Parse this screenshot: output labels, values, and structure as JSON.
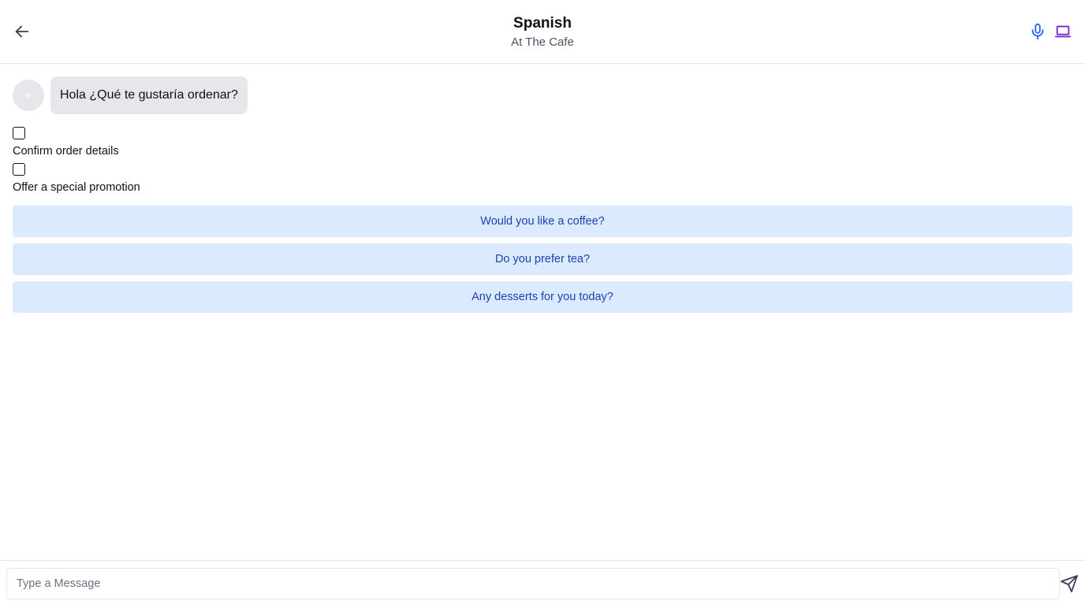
{
  "header": {
    "title": "Spanish",
    "subtitle": "At The Cafe",
    "icons": {
      "back": "arrow-left-icon",
      "mic": "microphone-icon",
      "laptop": "laptop-icon"
    },
    "colors": {
      "mic": "#2563eb",
      "laptop": "#7e22ce"
    }
  },
  "conversation": {
    "message": "Hola ¿Qué te gustaría ordenar?"
  },
  "goals": [
    {
      "label": "Confirm order details",
      "checked": false
    },
    {
      "label": "Offer a special promotion",
      "checked": false
    }
  ],
  "suggestions": [
    "Would you like a coffee?",
    "Do you prefer tea?",
    "Any desserts for you today?"
  ],
  "composer": {
    "placeholder": "Type a Message",
    "value": "",
    "send_icon": "send-icon"
  },
  "colors": {
    "suggestion_bg": "#dbeafe",
    "suggestion_text": "#1e40af",
    "bubble_bg": "#e5e7eb"
  }
}
